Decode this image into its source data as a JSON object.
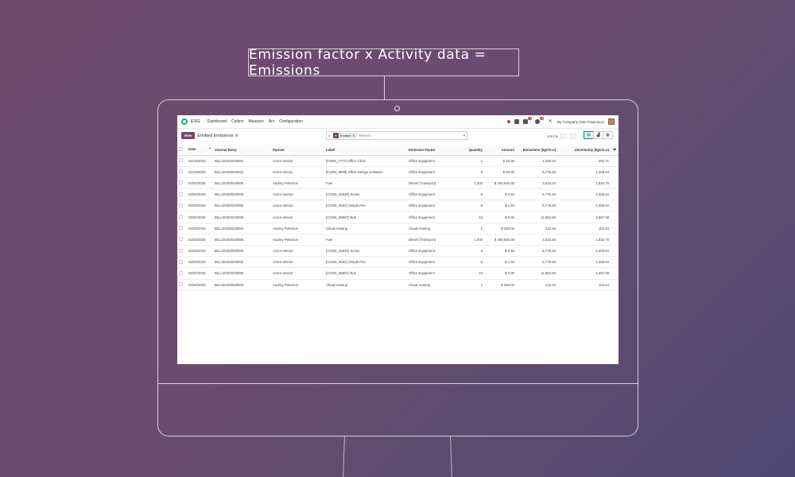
{
  "headline": "Emission factor x Activity data = Emissions",
  "topbar": {
    "app_name": "ESG",
    "menu": [
      "Dashboard",
      "Collect",
      "Measure",
      "Act",
      "Configuration"
    ],
    "badges": {
      "messages": "11",
      "activities": "19"
    },
    "company": "My Company (San Francisco)"
  },
  "controlbar": {
    "new_label": "New",
    "view_title": "Emitted Emissions",
    "facet_label": "Emitted",
    "search_placeholder": "Search...",
    "pager": "1-9 / 9"
  },
  "table": {
    "headers": [
      "Date",
      "Journal Entry",
      "Partner",
      "Label",
      "Emission Factor",
      "Quantity",
      "Amount",
      "Emissions (kgCO₂e)",
      "Uncertainty (kgCO₂e)"
    ],
    "rows": [
      [
        "03/19/2025",
        "BILL/2025/03/0001",
        "Azure Interior",
        "[FURN_7777] Office Chair",
        "Office Equipment",
        "1",
        "$ 10.00",
        "1,155.23",
        "265.71"
      ],
      [
        "03/19/2025",
        "BILL/2025/03/0001",
        "Azure Interior",
        "[FURN_9999] Office Design Software",
        "Office Equipment",
        "5",
        "$ 20.00",
        "5,776.25",
        "1,328.54"
      ],
      [
        "03/20/2025",
        "BILL/2025/03/0006",
        "Audrey Peterson",
        "Fuel",
        "Diesel (Transport)",
        "1,000",
        "$ 400,000.00",
        "3,233.40",
        "1,616.70"
      ],
      [
        "03/20/2025",
        "BILL/2025/03/0005",
        "Azure Interior",
        "[CONS_25630] Screw",
        "Office Equipment",
        "5",
        "$ 0.50",
        "5,776.25",
        "1,328.54"
      ],
      [
        "03/20/2025",
        "BILL/2025/03/0005",
        "Azure Interior",
        "[CONS_0002] Simple Pen",
        "Office Equipment",
        "5",
        "$ 1.50",
        "5,776.25",
        "1,328.54"
      ],
      [
        "03/20/2025",
        "BILL/2025/03/0005",
        "Azure Interior",
        "[CONS_89957] Bolt",
        "Office Equipment",
        "10",
        "$ 5.00",
        "11,552.50",
        "2,657.08"
      ],
      [
        "03/20/2025",
        "BILL/2025/03/0004",
        "Audrey Peterson",
        "Cloud Hosting",
        "Cloud Hosting",
        "1",
        "$ 250.00",
        "133.16",
        "102.53"
      ],
      [
        "03/20/2025",
        "BILL/2025/03/0006",
        "Audrey Peterson",
        "Fuel",
        "Diesel (Transport)",
        "1,000",
        "$ 400,000.00",
        "3,233.40",
        "1,616.70"
      ],
      [
        "03/20/2025",
        "BILL/2025/03/0005",
        "Azure Interior",
        "[CONS_25630] Screw",
        "Office Equipment",
        "5",
        "$ 0.50",
        "5,776.25",
        "1,328.54"
      ],
      [
        "03/20/2025",
        "BILL/2025/03/0005",
        "Azure Interior",
        "[CONS_0002] Simple Pen",
        "Office Equipment",
        "5",
        "$ 1.50",
        "5,776.25",
        "1,328.54"
      ],
      [
        "03/20/2025",
        "BILL/2025/03/0005",
        "Azure Interior",
        "[CONS_89957] Bolt",
        "Office Equipment",
        "10",
        "$ 5.00",
        "11,552.50",
        "2,657.08"
      ],
      [
        "03/20/2025",
        "BILL/2025/03/0004",
        "Audrey Peterson",
        "Cloud Hosting",
        "Cloud Hosting",
        "1",
        "$ 250.00",
        "133.16",
        "102.53"
      ]
    ]
  }
}
